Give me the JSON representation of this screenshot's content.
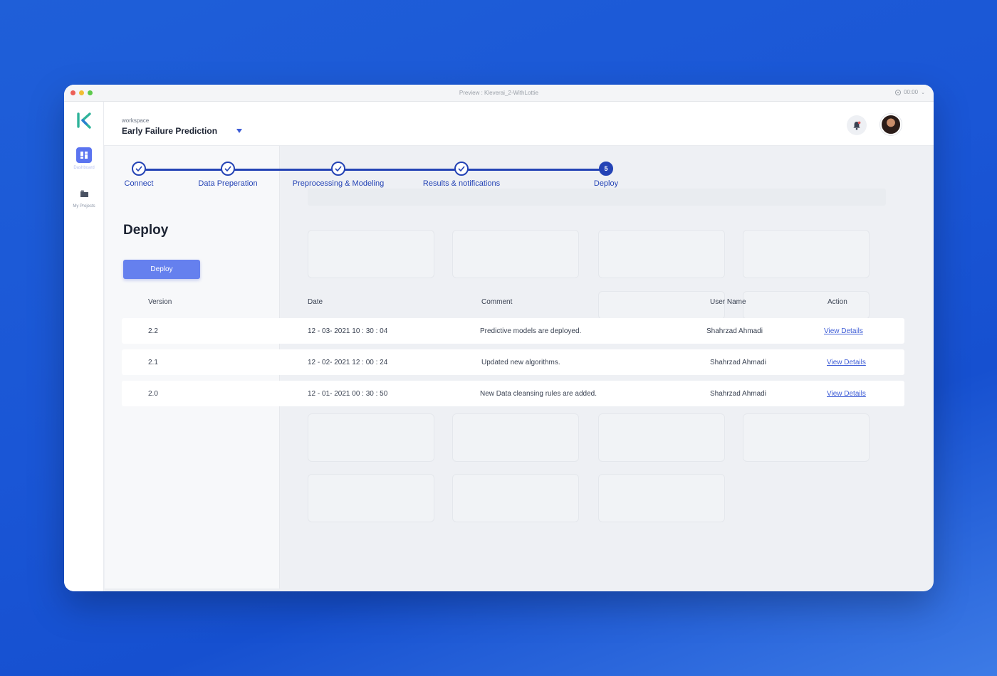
{
  "window": {
    "title": "Preview : Kleverai_2-WithLottie",
    "time": "00:00"
  },
  "sidebar": {
    "items": [
      {
        "label": "Dashboard",
        "icon": "dashboard-icon"
      },
      {
        "label": "My Projects",
        "icon": "folder-icon"
      }
    ]
  },
  "header": {
    "workspace_label": "workspace",
    "workspace_name": "Early Failure Prediction"
  },
  "stepper": {
    "steps": [
      {
        "label": "Connect",
        "state": "done"
      },
      {
        "label": "Data Preperation",
        "state": "done"
      },
      {
        "label": "Preprocessing & Modeling",
        "state": "done"
      },
      {
        "label": "Results & notifications",
        "state": "done"
      },
      {
        "label": "Deploy",
        "state": "active",
        "number": "5"
      }
    ]
  },
  "page": {
    "title": "Deploy",
    "deploy_button": "Deploy"
  },
  "table": {
    "headers": {
      "version": "Version",
      "date": "Date",
      "comment": "Comment",
      "user": "User Name",
      "action": "Action"
    },
    "rows": [
      {
        "version": "2.2",
        "date": "12 - 03- 2021   10 : 30 : 04",
        "comment": "Predictive models are deployed.",
        "user": "Shahrzad Ahmadi",
        "action": "View Details"
      },
      {
        "version": "2.1",
        "date": "12 - 02- 2021   12 : 00 : 24",
        "comment": "Updated new algorithms.",
        "user": "Shahrzad Ahmadi",
        "action": "View Details"
      },
      {
        "version": "2.0",
        "date": "12 - 01- 2021   00 : 30 : 50",
        "comment": "New Data cleansing rules are added.",
        "user": "Shahrzad Ahmadi",
        "action": "View Details"
      }
    ]
  },
  "colors": {
    "primary": "#2443b5",
    "button": "#6580ee",
    "link": "#3d5cd6",
    "brand_green": "#2fb39a",
    "background_blue": "#1a56d6"
  }
}
